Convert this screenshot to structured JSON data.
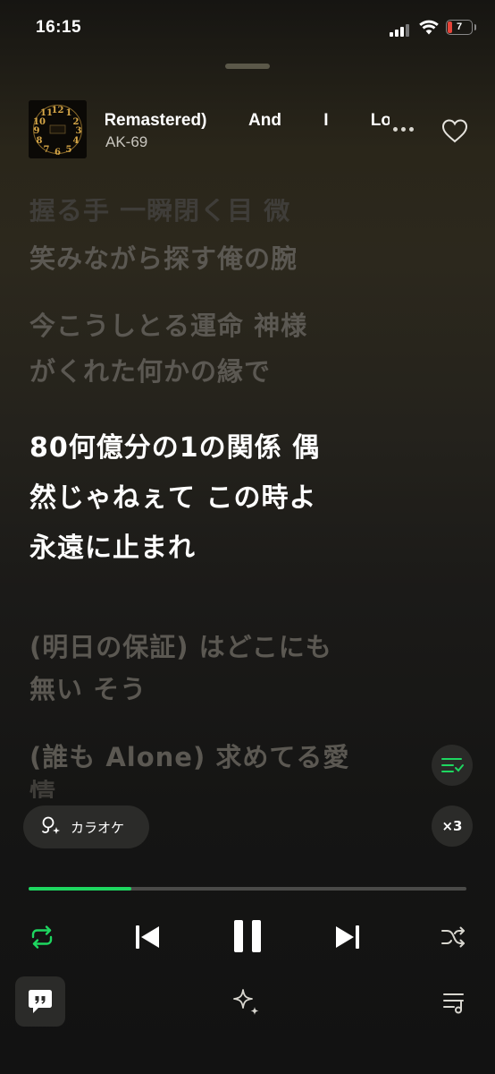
{
  "status_bar": {
    "time": "16:15",
    "battery": "7"
  },
  "track": {
    "title": "(Remastered) And I Love You So",
    "artist": "AK-69"
  },
  "lyrics": [
    {
      "text": "握る手 一瞬閉く目 微",
      "state": "fade"
    },
    {
      "text": "笑みながら探す俺の腕",
      "state": "past"
    },
    {
      "text": "今こうしとる運命 神様",
      "state": "past"
    },
    {
      "text": "がくれた何かの縁で",
      "state": "past"
    },
    {
      "text": "80何億分の1の関係 偶",
      "state": "active"
    },
    {
      "text": "然じゃねぇて この時よ",
      "state": "active"
    },
    {
      "text": "永遠に止まれ",
      "state": "active"
    },
    {
      "text": "(明日の保証) はどこにも",
      "state": "upcoming"
    },
    {
      "text": "無い そう",
      "state": "upcoming"
    },
    {
      "text": "(誰も Alone) 求めてる愛",
      "state": "upcoming"
    },
    {
      "text": "情",
      "state": "fade"
    }
  ],
  "karaoke": {
    "label": "カラオケ"
  },
  "speed": {
    "label": "×3"
  },
  "playback": {
    "progress": 0.235
  },
  "colors": {
    "accent": "#1ed760",
    "active_lyric": "#ffffff",
    "inactive_lyric": "#5b5852"
  },
  "icons": [
    "repeat-icon",
    "previous-icon",
    "pause-icon",
    "next-icon",
    "shuffle-icon",
    "chat-quote-icon",
    "sparkle-icon",
    "queue-icon",
    "heart-icon",
    "more-icon",
    "microphone-icon",
    "lyrics-list-icon"
  ]
}
